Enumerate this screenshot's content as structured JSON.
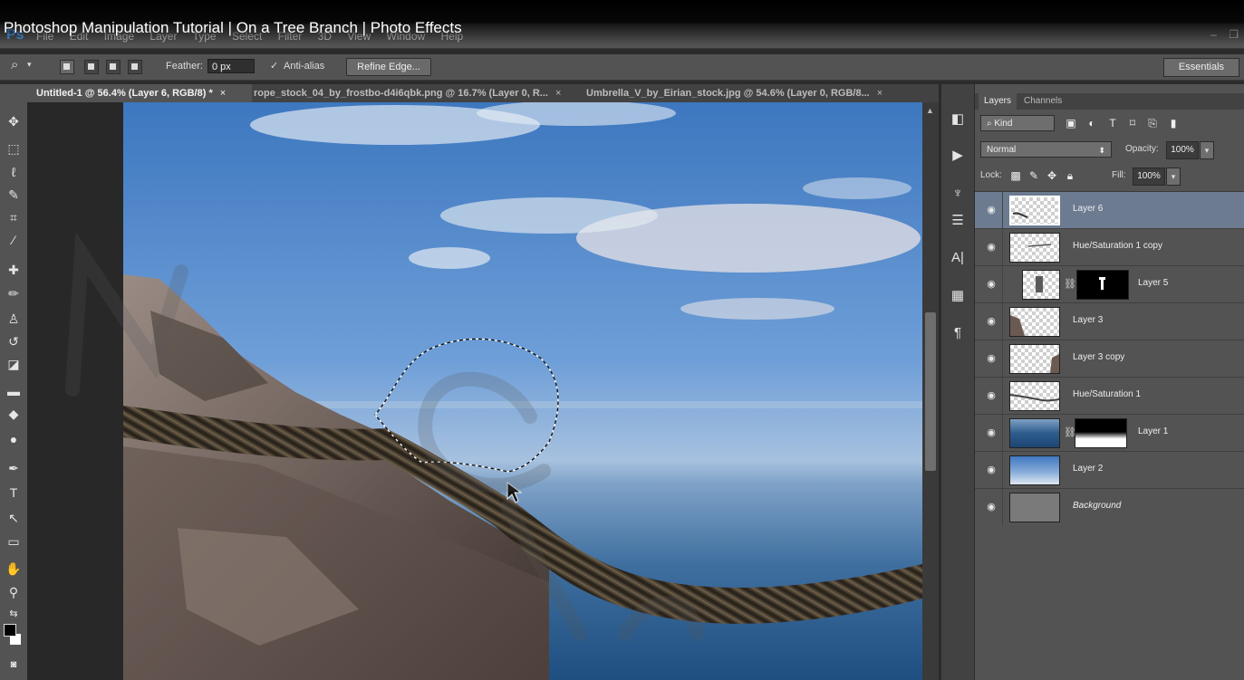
{
  "video_title": "Photoshop Manipulation Tutorial | On a Tree Branch | Photo Effects",
  "app": {
    "logo": "Ps",
    "accent": "#4aa3ff"
  },
  "menu": [
    "File",
    "Edit",
    "Image",
    "Layer",
    "Type",
    "Select",
    "Filter",
    "3D",
    "View",
    "Window",
    "Help"
  ],
  "window_controls": {
    "minimize": "–",
    "restore": "❐"
  },
  "options_bar": {
    "tool_icon": "lasso-icon",
    "feather_label": "Feather:",
    "feather_value": "0 px",
    "antialias_label": "Anti-alias",
    "antialias_checked": true,
    "refine_edge_label": "Refine Edge...",
    "workspace": "Essentials"
  },
  "doc_tabs": [
    {
      "label": "Untitled-1 @ 56.4% (Layer 6, RGB/8) *",
      "active": true
    },
    {
      "label": "rope_stock_04_by_frostbo-d4i6qbk.png @ 16.7% (Layer 0, R...",
      "active": false
    },
    {
      "label": "Umbrella_V_by_Eirian_stock.jpg @ 54.6% (Layer 0, RGB/8...",
      "active": false
    }
  ],
  "close_glyph": "×",
  "layers_panel": {
    "tabs": [
      "Layers",
      "Channels"
    ],
    "active_tab": "Layers",
    "kind_label": "Kind",
    "blend_mode": "Normal",
    "opacity_label": "Opacity:",
    "opacity_value": "100%",
    "lock_label": "Lock:",
    "fill_label": "Fill:",
    "fill_value": "100%",
    "layers": [
      {
        "name": "Layer 6",
        "selected": true,
        "mask": false,
        "thumb": "rope-stroke"
      },
      {
        "name": "Hue/Saturation 1 copy",
        "selected": false,
        "mask": false,
        "thumb": "line"
      },
      {
        "name": "Layer 5",
        "selected": false,
        "mask": true,
        "thumb": "figure"
      },
      {
        "name": "Layer 3",
        "selected": false,
        "mask": false,
        "thumb": "rock-left"
      },
      {
        "name": "Layer 3 copy",
        "selected": false,
        "mask": false,
        "thumb": "rock-right"
      },
      {
        "name": "Hue/Saturation 1",
        "selected": false,
        "mask": false,
        "thumb": "rope-line"
      },
      {
        "name": "Layer 1",
        "selected": false,
        "mask": true,
        "thumb": "sea"
      },
      {
        "name": "Layer 2",
        "selected": false,
        "mask": false,
        "thumb": "sky"
      },
      {
        "name": "Background",
        "selected": false,
        "mask": false,
        "thumb": "gray",
        "italic": true
      }
    ]
  }
}
